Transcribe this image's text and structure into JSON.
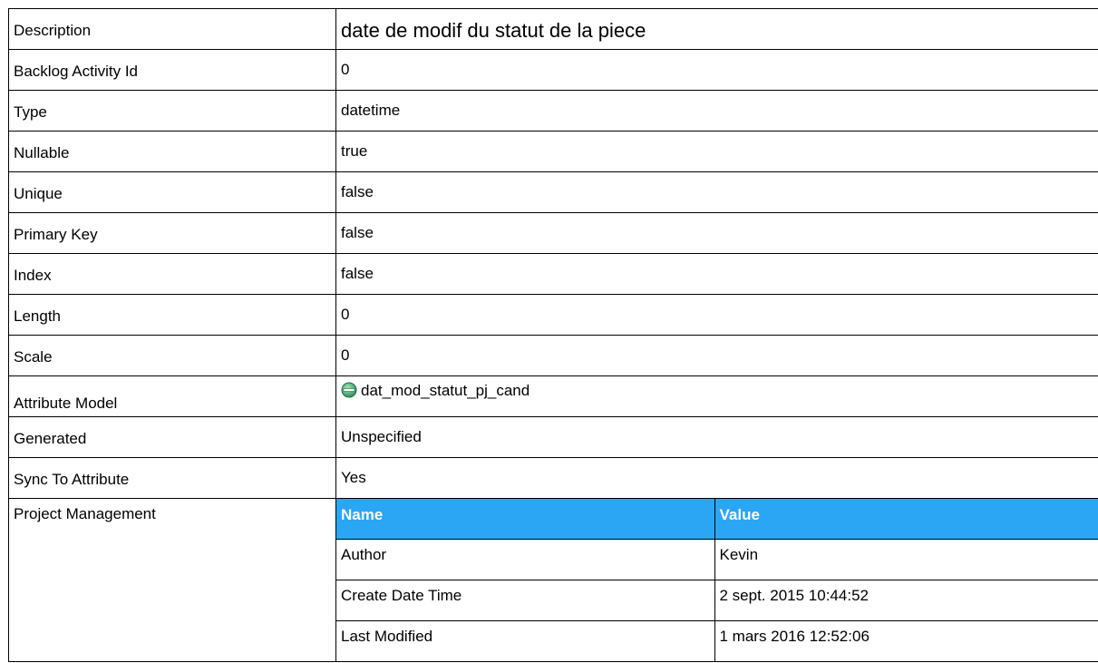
{
  "properties": [
    {
      "label": "Description",
      "value": "date de modif du statut de la piece"
    },
    {
      "label": "Backlog Activity Id",
      "value": "0"
    },
    {
      "label": "Type",
      "value": "datetime"
    },
    {
      "label": "Nullable",
      "value": "true"
    },
    {
      "label": "Unique",
      "value": "false"
    },
    {
      "label": "Primary Key",
      "value": "false"
    },
    {
      "label": "Index",
      "value": "false"
    },
    {
      "label": "Length",
      "value": "0"
    },
    {
      "label": "Scale",
      "value": "0"
    },
    {
      "label": "Attribute Model",
      "value": "dat_mod_statut_pj_cand",
      "icon": "attribute-icon"
    },
    {
      "label": "Generated",
      "value": "Unspecified"
    },
    {
      "label": "Sync To Attribute",
      "value": "Yes"
    }
  ],
  "project_management": {
    "label": "Project Management",
    "headers": {
      "name": "Name",
      "value": "Value"
    },
    "rows": [
      {
        "name": "Author",
        "value": "Kevin"
      },
      {
        "name": "Create Date Time",
        "value": "2 sept. 2015 10:44:52"
      },
      {
        "name": "Last Modified",
        "value": "1 mars 2016 12:52:06"
      }
    ]
  },
  "colors": {
    "header_bg": "#2aa6f5",
    "header_text": "#ffffff",
    "border": "#000000",
    "icon_fill": "#3cb371"
  }
}
